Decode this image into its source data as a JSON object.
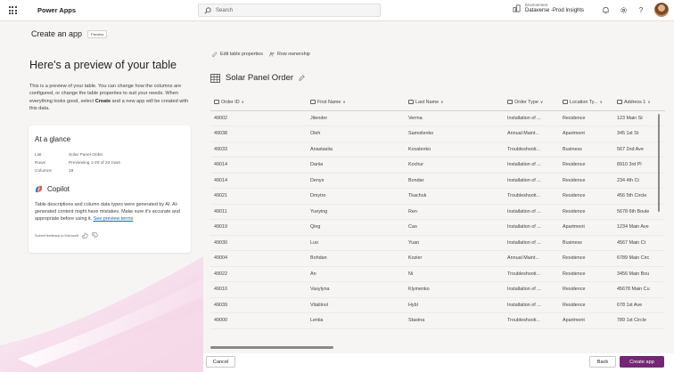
{
  "topbar": {
    "app_name": "Power Apps",
    "search_placeholder": "Search",
    "environment_label": "Environment",
    "environment_name": "Dataverse -Prod Insights"
  },
  "page": {
    "title": "Create an app",
    "badge": "Preview"
  },
  "left": {
    "heading": "Here's a preview of your table",
    "description_1": "This is a preview of your table. You can change how the columns are configured, or change the table properties to suit your needs. When everything looks good, select ",
    "description_bold": "Create",
    "description_2": " and a new app will be created with this data.",
    "glance": {
      "title": "At a glance",
      "rows": [
        {
          "key": "List",
          "value": "Solar Panel Order"
        },
        {
          "key": "Rows",
          "value": "Previewing 1-20 of 22 rows"
        },
        {
          "key": "Columns",
          "value": "18"
        }
      ]
    },
    "copilot": {
      "title": "Copilot",
      "description": "Table descriptions and column data types were generated by AI. AI-generated content might have mistakes. Make sure it's accurate and appropriate before using it. ",
      "link": "See preview terms",
      "feedback": "Submit feedback to Microsoft"
    }
  },
  "right": {
    "toolbar": {
      "edit_label": "Edit table properties",
      "ownership_label": "Row ownership"
    },
    "table_name": "Solar Panel Order",
    "columns": [
      "Order ID",
      "First Name",
      "Last Name",
      "Order Type",
      "Location Ty...",
      "Address 1"
    ],
    "rows": [
      [
        "49002",
        "Jitender",
        "Verma",
        "Installation of ...",
        "Residence",
        "123 Main St"
      ],
      [
        "49038",
        "Oleh",
        "Samoilenko",
        "Annual Maint...",
        "Apartment",
        "345 1st St"
      ],
      [
        "49033",
        "Anastasiia",
        "Kovalenko",
        "Troubleshooti...",
        "Business",
        "567 2nd Ave"
      ],
      [
        "49014",
        "Dariia",
        "Kochur",
        "Installation of ...",
        "Residence",
        "8910 3rd Pl"
      ],
      [
        "49014",
        "Denys",
        "Bondar",
        "Installation of ...",
        "Residence",
        "234 4th Ct"
      ],
      [
        "49021",
        "Dmytro",
        "Tkachuk",
        "Troubleshooti...",
        "Residence",
        "456 5th Circle"
      ],
      [
        "49011",
        "Yueying",
        "Ren",
        "Installation of ...",
        "Residence",
        "5678 6th Boule"
      ],
      [
        "49019",
        "Qing",
        "Cao",
        "Installation of ...",
        "Apartment",
        "1234 Main Ave"
      ],
      [
        "49030",
        "Luo",
        "Yuan",
        "Installation of ...",
        "Business",
        "4567 Main Ct"
      ],
      [
        "49004",
        "Bohdan",
        "Kozier",
        "Annual Maint...",
        "Residence",
        "6789 Main Circ"
      ],
      [
        "49022",
        "An",
        "Ni",
        "Troubleshooti...",
        "Residence",
        "3456 Main Bou"
      ],
      [
        "49010",
        "Vasylyna",
        "Klymenko",
        "Installation of ...",
        "Residence",
        "45678 Main Cu"
      ],
      [
        "49039",
        "Vitaliinol",
        "Hybl",
        "Installation of ...",
        "Residence",
        "678 1st Ave"
      ],
      [
        "49000",
        "Leniia",
        "Stastna",
        "Troubleshooti...",
        "Apartment",
        "789 1st Circle"
      ]
    ]
  },
  "footer": {
    "cancel": "Cancel",
    "back": "Back",
    "create": "Create app"
  },
  "colors": {
    "primary": "#742774",
    "link": "#0f6cbd"
  }
}
